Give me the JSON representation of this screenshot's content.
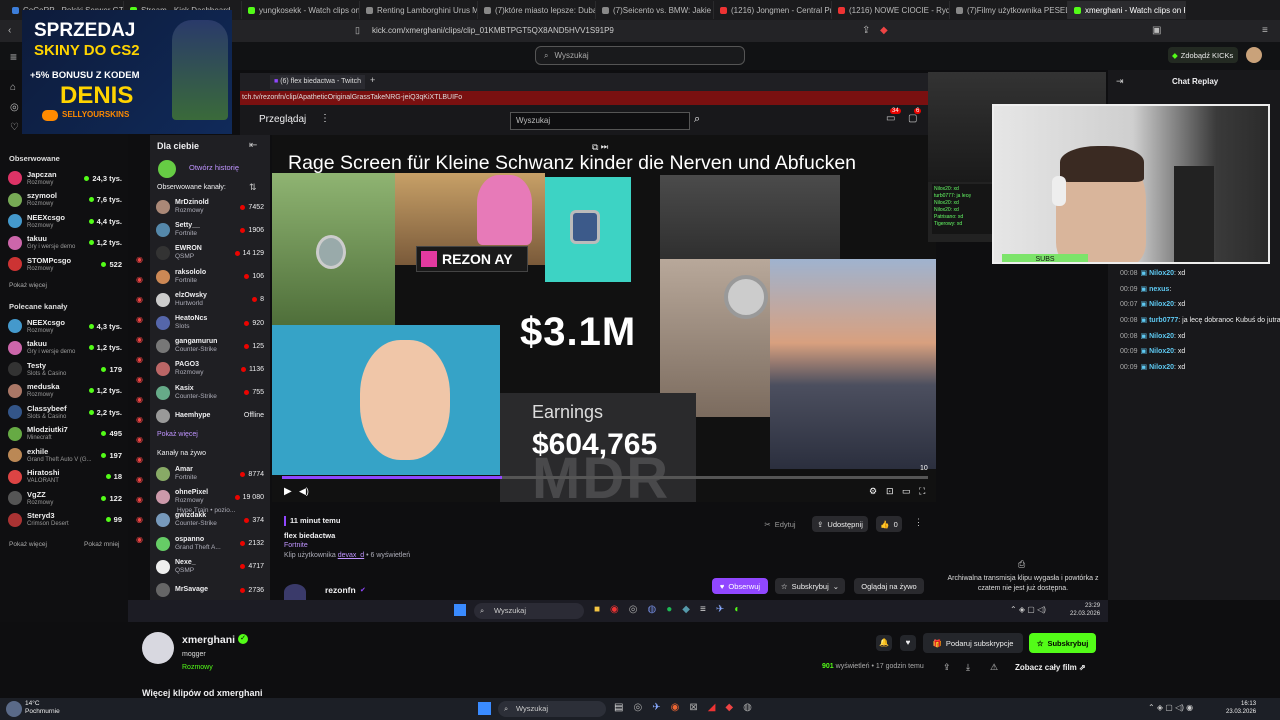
{
  "browser": {
    "tabs": [
      {
        "label": "CoCoRP - Polski Serwer GTA RP W...",
        "color": "#3c7dd9"
      },
      {
        "label": "Stream - Kick Dashboard",
        "color": "#53fc18"
      },
      {
        "label": "yungkosekk - Watch clips on Kick",
        "color": "#53fc18"
      },
      {
        "label": "Renting Lamborghini Urus Miami",
        "color": "#888"
      },
      {
        "label": "(7)które miasto lepsze: Dubaj czy...",
        "color": "#888"
      },
      {
        "label": "(7)Seicento vs. BMW: Jakie auto k...",
        "color": "#888"
      },
      {
        "label": "(1216) Jongmen - Central Prison O...",
        "color": "#e33"
      },
      {
        "label": "(1216) NOWE CIOCIE - Rydawami...",
        "color": "#e33"
      },
      {
        "label": "(7)Filmy użytkownika PESEL | ciekl...",
        "color": "#888"
      },
      {
        "label": "xmerghani - Watch clips on Kick",
        "color": "#53fc18"
      }
    ],
    "url": "kick.com/xmerghani/clips/clip_01KMBTPGT5QX8AND5HVV1S91P9"
  },
  "kick": {
    "search_placeholder": "Wyszukaj",
    "kicks_button": "Zdobądź KICKs",
    "followed_header": "Obserwowane",
    "followed": [
      {
        "name": "Japczan",
        "category": "Rozmowy",
        "viewers": "24,3 tys.",
        "color": "#d36"
      },
      {
        "name": "szymool",
        "category": "Rozmowy",
        "viewers": "7,6 tys.",
        "color": "#7a5"
      },
      {
        "name": "NEEXcsgo",
        "category": "Rozmowy",
        "viewers": "4,4 tys.",
        "color": "#49c"
      },
      {
        "name": "takuu",
        "category": "Gry i wersje demo",
        "viewers": "1,2 tys.",
        "color": "#c6a"
      },
      {
        "name": "STOMPcsgo",
        "category": "Rozmowy",
        "viewers": "522",
        "color": "#c33"
      }
    ],
    "show_more": "Pokaż więcej",
    "recommended_header": "Polecane kanały",
    "recommended": [
      {
        "name": "NEEXcsgo",
        "category": "Rozmowy",
        "viewers": "4,3 tys.",
        "color": "#49c"
      },
      {
        "name": "takuu",
        "category": "Gry i wersje demo",
        "viewers": "1,2 tys.",
        "color": "#c6a"
      },
      {
        "name": "Testy",
        "category": "Slots & Casino",
        "viewers": "179",
        "color": "#333"
      },
      {
        "name": "meduska",
        "category": "Rozmowy",
        "viewers": "1,2 tys.",
        "color": "#a76"
      },
      {
        "name": "Classybeef",
        "category": "Slots & Casino",
        "viewers": "2,2 tys.",
        "color": "#358"
      },
      {
        "name": "Mlodziutki7",
        "category": "Minecraft",
        "viewers": "495",
        "color": "#6a4"
      },
      {
        "name": "exhile",
        "category": "Grand Theft Auto V (G...",
        "viewers": "197",
        "color": "#b85"
      },
      {
        "name": "Hiratoshi",
        "category": "VALORANT",
        "viewers": "18",
        "color": "#d44"
      },
      {
        "name": "VgZZ",
        "category": "Rozmowy",
        "viewers": "122",
        "color": "#555"
      },
      {
        "name": "Steryd3",
        "category": "Crimson Desert",
        "viewers": "99",
        "color": "#a33"
      }
    ],
    "show_more2": "Pokaż więcej",
    "show_less": "Pokaż mniej",
    "channel": {
      "name": "xmerghani",
      "bio": "mogger",
      "category": "Rozmowy",
      "views": "901",
      "views_label": "wyświetleń",
      "time": "17 godzin temu",
      "watch_full": "Zobacz cały film",
      "gift_sub": "Podaruj subskrypcje",
      "subscribe": "Subskrybuj",
      "more_clips": "Więcej klipów od xmerghani"
    }
  },
  "promo": {
    "line1": "SPRZEDAJ",
    "line2": "SKINY DO CS2",
    "line3": "+5% BONUSU Z KODEM",
    "line4": "DENIS",
    "brand": "SELLYOURSKINS"
  },
  "twitch": {
    "tab_label": "(6) flex biedactwa - Twitch",
    "url": "tch.tv/rezonfn/clip/ApatheticOriginalGrassTakeNRG-jeiQ3qKiXTLBUIFo",
    "browse": "Przeglądaj",
    "search_placeholder": "Wyszukaj",
    "badge_a": "34",
    "badge_b": "6",
    "for_you": "Dla ciebie",
    "history": "Otwórz historię",
    "followed_header": "Obserwowane kanały:",
    "followed": [
      {
        "name": "MrDzinold",
        "category": "Rozmowy",
        "viewers": "7452",
        "color": "#a87"
      },
      {
        "name": "Setty__",
        "category": "Fortnite",
        "viewers": "1906",
        "color": "#58a"
      },
      {
        "name": "EWRON",
        "category": "QSMP",
        "viewers": "14 129",
        "color": "#333"
      },
      {
        "name": "raksololo",
        "category": "Fortnite",
        "viewers": "106",
        "color": "#c85"
      },
      {
        "name": "elzOwsky",
        "category": "Hurtworld",
        "viewers": "8",
        "color": "#ccc"
      },
      {
        "name": "HeatoNcs",
        "category": "Slots",
        "viewers": "920",
        "color": "#56a"
      },
      {
        "name": "gangamurun",
        "category": "Counter-Strike",
        "viewers": "125",
        "color": "#777"
      },
      {
        "name": "PAGO3",
        "category": "Rozmowy",
        "viewers": "1136",
        "color": "#b66"
      },
      {
        "name": "Kasix",
        "category": "Counter-Strike",
        "viewers": "755",
        "color": "#6a8"
      },
      {
        "name": "Haemhype",
        "category": "",
        "viewers": "Offline",
        "color": "#999"
      }
    ],
    "show_more": "Pokaż więcej",
    "live_header": "Kanały na żywo",
    "live": [
      {
        "name": "Amar",
        "category": "Fortnite",
        "viewers": "8774",
        "color": "#8a6"
      },
      {
        "name": "ohnePixel",
        "category": "Rozmowy",
        "viewers": "19 080",
        "color": "#c9a"
      },
      {
        "name": "gwizdakk",
        "category": "Counter-Strike",
        "viewers": "374",
        "color": "#79b"
      },
      {
        "name": "ospanno",
        "category": "Grand Theft A...",
        "viewers": "2132",
        "color": "#6c6"
      },
      {
        "name": "Nexe_",
        "category": "QSMP",
        "viewers": "4717",
        "color": "#eee"
      },
      {
        "name": "MrSavage",
        "category": "",
        "viewers": "2736",
        "color": "#666"
      }
    ],
    "hype_train": "Hype Train • pozio...",
    "video": {
      "title": "Rage Screen für Kleine Schwanz kinder die Nerven und Abfucken",
      "rezon": "REZON AY",
      "money1": "$3.1M",
      "earnings": "Earnings",
      "money2": "$604,765",
      "mdr": "MDR",
      "timecode": "10",
      "progress": 0.34
    },
    "clip": {
      "ago": "11 minut temu",
      "title": "flex biedactwa",
      "game": "Fortnite",
      "by_prefix": "Klip użytkownika",
      "author": "devax_d",
      "views": "• 6 wyświetleń",
      "edit": "Edytuj",
      "share": "Udostępnij",
      "likes": "0",
      "channel": "rezonfn",
      "follow": "Obserwuj",
      "subscribe": "Subskrybuj",
      "watch_live": "Oglądaj na żywo"
    }
  },
  "chat": {
    "header": "Chat Replay",
    "subs": "SUBS",
    "messages": [
      {
        "time": "00:08",
        "user": "Nilox20",
        "text": ": xd"
      },
      {
        "time": "00:09",
        "user": "nexus",
        "text": ":"
      },
      {
        "time": "00:07",
        "user": "Nilox20",
        "text": ": xd"
      },
      {
        "time": "00:08",
        "user": "turb0777",
        "text": ": ja lecę dobranoc Kubuś do jutra"
      },
      {
        "time": "00:08",
        "user": "Nilox20",
        "text": ": xd"
      },
      {
        "time": "00:09",
        "user": "Nilox20",
        "text": ": xd"
      },
      {
        "time": "00:09",
        "user": "Nilox20",
        "text": ": xd"
      }
    ],
    "expired": "Archiwalna transmisja klipu wygasła i powtórka z czatem nie jest już dostępna."
  },
  "taskbar_inner": {
    "search": "Wyszukaj",
    "time": "23:29",
    "date": "22.03.2026"
  },
  "taskbar_outer": {
    "search": "Wyszukaj",
    "temp": "14°C",
    "weather": "Pochmurnie",
    "time": "16:13",
    "date": "23.03.2026"
  }
}
